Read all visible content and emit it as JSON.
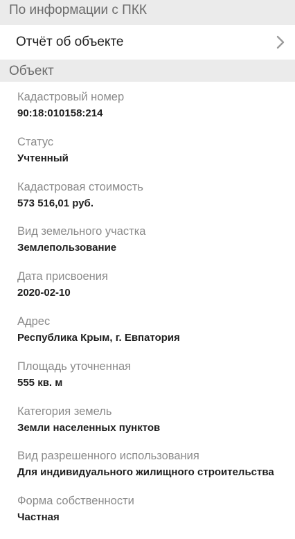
{
  "header_pkk": "По информации с ПКК",
  "report_row": {
    "label": "Отчёт об объекте",
    "icon": "chevron-right-icon"
  },
  "header_object": "Объект",
  "fields": [
    {
      "label": "Кадастровый номер",
      "value": "90:18:010158:214"
    },
    {
      "label": "Статус",
      "value": "Учтенный"
    },
    {
      "label": "Кадастровая стоимость",
      "value": "573 516,01 руб."
    },
    {
      "label": "Вид земельного участка",
      "value": "Землепользование"
    },
    {
      "label": "Дата присвоения",
      "value": "2020-02-10"
    },
    {
      "label": "Адрес",
      "value": "Республика Крым, г. Евпатория"
    },
    {
      "label": "Площадь уточненная",
      "value": "555 кв. м"
    },
    {
      "label": "Категория земель",
      "value": "Земли населенных пунктов"
    },
    {
      "label": "Вид разрешенного использования",
      "value": "Для индивидуального жилищного строительства"
    },
    {
      "label": "Форма собственности",
      "value": "Частная"
    }
  ],
  "colors": {
    "header_bg": "#ebebeb",
    "header_text": "#6b6b6b",
    "label_text": "#8a8a8a",
    "value_text": "#1f1f1f"
  }
}
